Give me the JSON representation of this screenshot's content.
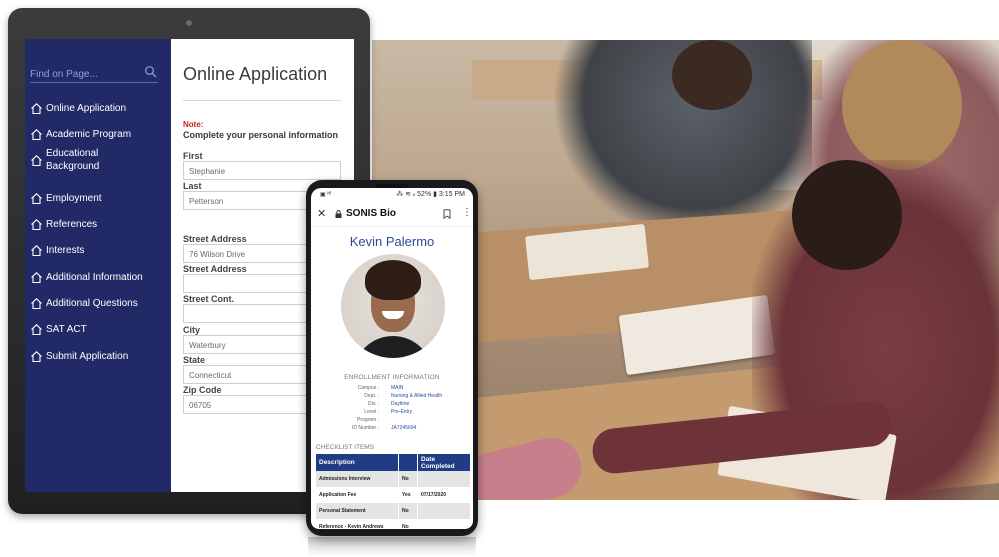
{
  "tablet": {
    "search": {
      "placeholder": "Find on Page..."
    },
    "nav": [
      {
        "label": "Online Application"
      },
      {
        "label": "Academic Program"
      },
      {
        "label": "Educational Background"
      },
      {
        "label": "Employment"
      },
      {
        "label": "References"
      },
      {
        "label": "Interests"
      },
      {
        "label": "Additional Information"
      },
      {
        "label": "Additional Questions"
      },
      {
        "label": "SAT ACT"
      },
      {
        "label": "Submit Application"
      }
    ],
    "form": {
      "title": "Online Application",
      "note": "Note:",
      "subtitle": "Complete your personal information",
      "fields": [
        {
          "label": "First",
          "value": "Stephanie"
        },
        {
          "label": "Last",
          "value": "Petterson"
        },
        {
          "label": "Street Address",
          "value": "76 Wilson Drive"
        },
        {
          "label": "Street Address",
          "value": ""
        },
        {
          "label": "Street Cont.",
          "value": ""
        },
        {
          "label": "City",
          "value": "Waterbury"
        },
        {
          "label": "State",
          "value": "Connecticut"
        },
        {
          "label": "Zip Code",
          "value": "06705"
        }
      ]
    }
  },
  "phone": {
    "status": {
      "left": "▣ ᴺᶠ",
      "right": "⁂ ≋ ᵢₗ 52% ▮ 3:15 PM"
    },
    "appbar": {
      "close": "✕",
      "title": "SONIS Bio",
      "more": "⋮"
    },
    "student_name": "Kevin Palermo",
    "enrollment": {
      "heading": "ENROLLMENT INFORMATION",
      "rows": [
        {
          "key": "Campus :",
          "value": "MAIN"
        },
        {
          "key": "Dept. :",
          "value": "Nursing & Allied Health"
        },
        {
          "key": "Div. :",
          "value": "Daytime"
        },
        {
          "key": "Level :",
          "value": "Pre-Entry"
        },
        {
          "key": "Program :",
          "value": ""
        },
        {
          "key": "ID Number :",
          "value": "JA7245694"
        }
      ]
    },
    "checklist": {
      "heading": "CHECKLIST ITEMS",
      "columns": [
        "Description",
        "",
        "Date Completed"
      ],
      "rows": [
        {
          "desc": "Admissions Interview",
          "status": "No",
          "date": ""
        },
        {
          "desc": "Application Fee",
          "status": "Yes",
          "date": "07/17/2020"
        },
        {
          "desc": "Personal Statement",
          "status": "No",
          "date": ""
        },
        {
          "desc": "Reference - Kevin Andrews",
          "status": "No",
          "date": ""
        }
      ]
    }
  },
  "colors": {
    "sidebar": "#212a66",
    "accent_blue": "#2a4d9a",
    "table_header": "#1f3c85",
    "note_red": "#c31f1f"
  },
  "icons": [
    "search-icon",
    "home-outline-icon",
    "lock-icon",
    "bookmark-icon",
    "close-icon",
    "more-vert-icon"
  ]
}
